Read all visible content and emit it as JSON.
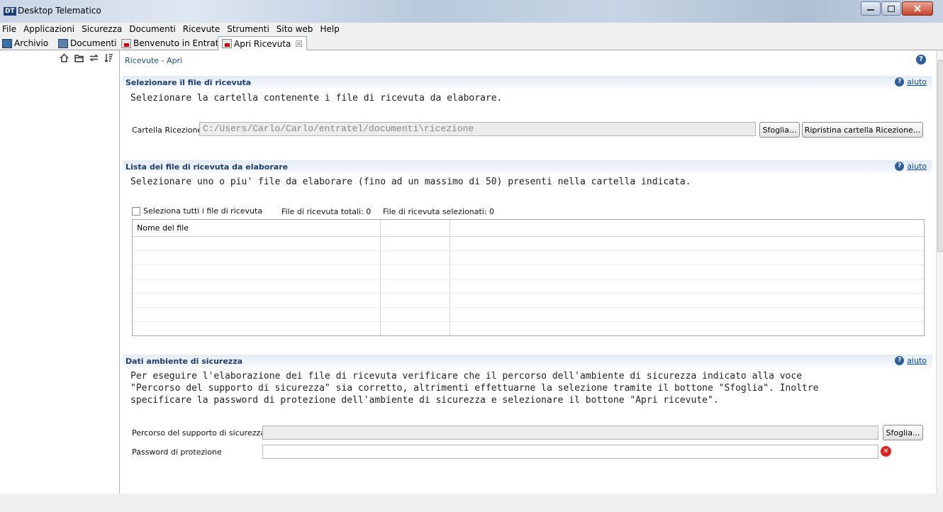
{
  "window": {
    "logo": "DT",
    "title": "Desktop Telematico"
  },
  "menu": [
    "File",
    "Applicazioni",
    "Sicurezza",
    "Documenti",
    "Ricevute",
    "Strumenti",
    "Sito web",
    "Help"
  ],
  "tabs": {
    "archivio": "Archivio",
    "documenti": "Documenti",
    "benvenuto": "Benvenuto in Entratel",
    "apri": "Apri Ricevuta",
    "close_glyph": "☒"
  },
  "breadcrumb": "Ricevute - Apri",
  "help_glyph": "?",
  "aiuto_label": "aiuto",
  "section1": {
    "title": "Selezionare il file di ricevuta",
    "description": "Selezionare la cartella contenente i file di ricevuta da elaborare.",
    "folder_label": "Cartella Ricezione",
    "folder_value": "C:/Users/Carlo/Carlo/entratel/documenti\\ricezione",
    "browse_button": "Sfoglia...",
    "reset_button": "Ripristina cartella Ricezione..."
  },
  "section2": {
    "title": "Lista dei file di ricevuta da elaborare",
    "description": "Selezionare uno o piu' file da elaborare (fino ad un massimo di 50) presenti nella cartella indicata.",
    "select_all": "Seleziona tutti i file di ricevuta",
    "total": "File di ricevuta totali: 0",
    "selected": "File di ricevuta selezionati: 0",
    "columns": [
      "Nome del file",
      "",
      ""
    ]
  },
  "section3": {
    "title": "Dati ambiente di sicurezza",
    "description_lines": [
      "Per eseguire l'elaborazione dei file di ricevuta verificare che il percorso dell'ambiente di sicurezza indicato alla voce",
      "\"Percorso del supporto di sicurezza\" sia corretto, altrimenti effettuarne la selezione tramite il bottone \"Sfoglia\". Inoltre",
      "specificare la password di protezione dell'ambiente di sicurezza e selezionare il bottone \"Apri ricevute\"."
    ],
    "path_label": "Percorso del supporto di sicurezza",
    "path_value": "",
    "browse_button": "Sfoglia...",
    "password_label": "Password di protezione",
    "password_value": ""
  },
  "icons": {
    "home": "home-icon",
    "folder": "folder-icon",
    "sync": "sync-icon",
    "sort": "sort-icon",
    "error": "error-icon"
  }
}
